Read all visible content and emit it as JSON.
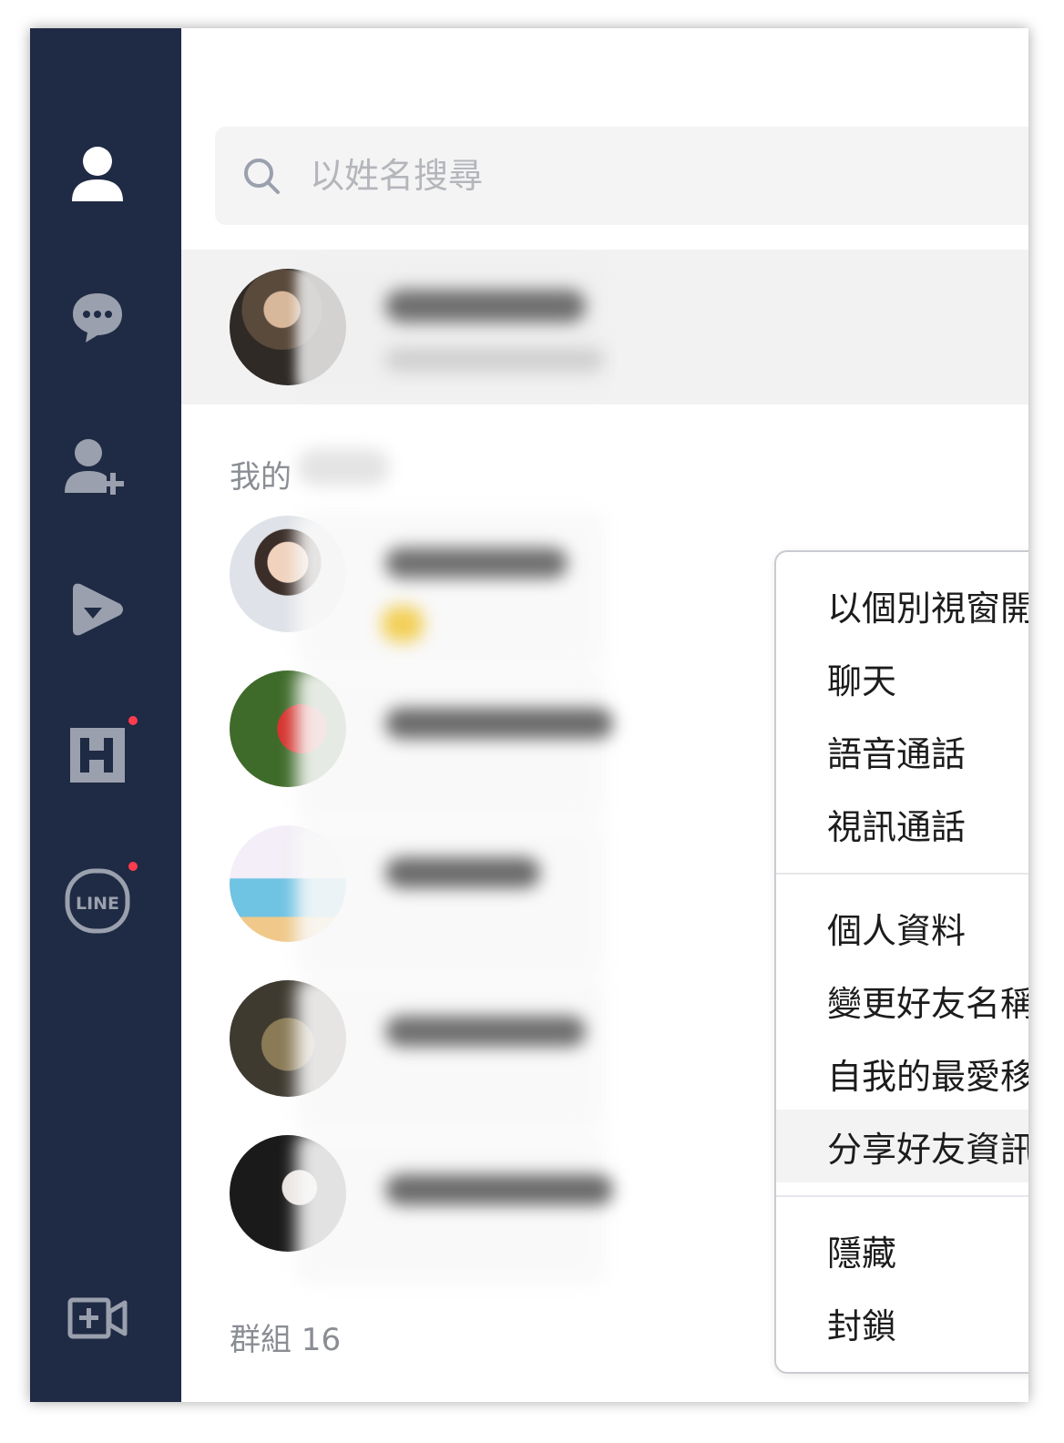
{
  "sidebar": {
    "items": [
      {
        "name": "friends",
        "icon": "person-icon",
        "active": true
      },
      {
        "name": "chats",
        "icon": "chat-bubble-icon",
        "active": false
      },
      {
        "name": "add-friend",
        "icon": "add-friend-icon",
        "active": false
      },
      {
        "name": "line-voom",
        "icon": "play-icon",
        "active": false
      },
      {
        "name": "today",
        "icon": "h-square-icon",
        "active": false,
        "notification": true
      },
      {
        "name": "line",
        "icon": "line-logo-icon",
        "label": "LINE",
        "active": false,
        "notification": true
      },
      {
        "name": "meeting",
        "icon": "video-add-icon",
        "active": false
      }
    ],
    "line_label": "LINE"
  },
  "search": {
    "placeholder": "以姓名搜尋"
  },
  "sections": {
    "favorites_prefix": "我的",
    "groups_label": "群組 16"
  },
  "context_menu": {
    "group1": [
      "以個別視窗開啟",
      "聊天",
      "語音通話",
      "視訊通話"
    ],
    "group2": [
      "個人資料",
      "變更好友名稱",
      "自我的最愛移除",
      "分享好友資訊"
    ],
    "group3": [
      "隱藏",
      "封鎖"
    ],
    "hovered_item": "分享好友資訊"
  },
  "colors": {
    "sidebar_bg": "#1f2a44",
    "sidebar_icon_active": "#ffffff",
    "sidebar_icon_inactive": "#9aa0ad",
    "notification": "#ff3b4e"
  }
}
